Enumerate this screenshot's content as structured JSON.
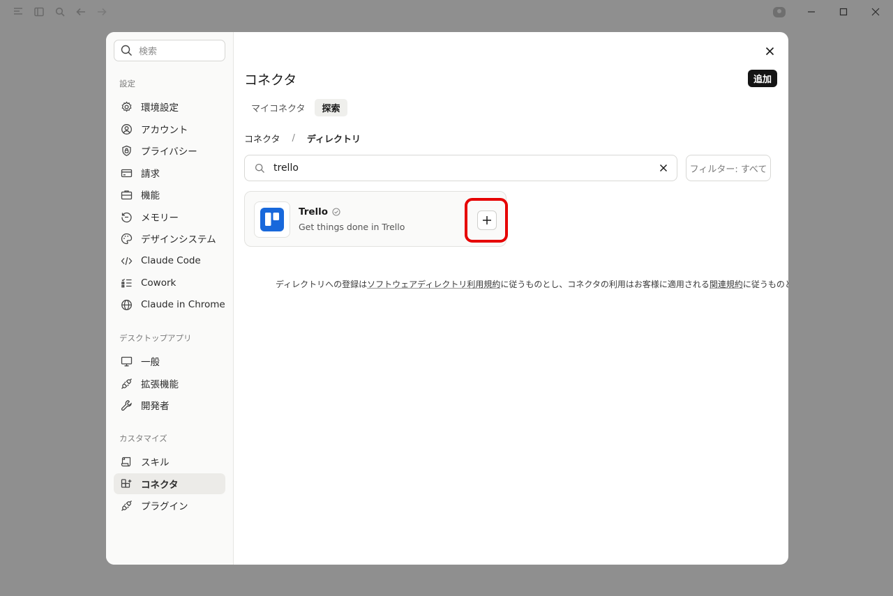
{
  "window": {
    "titlebar_icons": [
      "sidebar-toggle-icon",
      "panel-icon",
      "search-icon",
      "back-icon",
      "forward-icon"
    ],
    "controls": [
      "minimize-icon",
      "maximize-icon",
      "close-icon"
    ]
  },
  "sidebar": {
    "search_placeholder": "検索",
    "sections": [
      {
        "label": "設定",
        "items": [
          {
            "label": "環境設定",
            "icon": "gear-icon"
          },
          {
            "label": "アカウント",
            "icon": "user-circle-icon"
          },
          {
            "label": "プライバシー",
            "icon": "shield-lock-icon"
          },
          {
            "label": "請求",
            "icon": "credit-card-icon"
          },
          {
            "label": "機能",
            "icon": "briefcase-icon"
          },
          {
            "label": "メモリー",
            "icon": "history-icon"
          },
          {
            "label": "デザインシステム",
            "icon": "palette-icon"
          },
          {
            "label": "Claude Code",
            "icon": "code-icon"
          },
          {
            "label": "Cowork",
            "icon": "checklist-icon"
          },
          {
            "label": "Claude in Chrome",
            "icon": "globe-icon"
          }
        ]
      },
      {
        "label": "デスクトップアプリ",
        "items": [
          {
            "label": "一般",
            "icon": "monitor-icon"
          },
          {
            "label": "拡張機能",
            "icon": "plug-icon"
          },
          {
            "label": "開発者",
            "icon": "wrench-icon"
          }
        ]
      },
      {
        "label": "カスタマイズ",
        "items": [
          {
            "label": "スキル",
            "icon": "scroll-icon"
          },
          {
            "label": "コネクタ",
            "icon": "connector-icon",
            "active": true
          },
          {
            "label": "プラグイン",
            "icon": "plug-icon"
          }
        ]
      }
    ]
  },
  "main": {
    "title": "コネクタ",
    "add_label": "追加",
    "tabs": [
      {
        "label": "マイコネクタ",
        "active": false
      },
      {
        "label": "探索",
        "active": true
      }
    ],
    "breadcrumb": {
      "parent": "コネクタ",
      "separator": "/",
      "current": "ディレクトリ"
    },
    "search_value": "trello",
    "filter_label": "フィルター: すべて",
    "results": [
      {
        "name": "Trello",
        "description": "Get things done in Trello",
        "verified": true,
        "brand_color": "#1868db"
      }
    ],
    "terms": {
      "part1": "ディレクトリへの登録は",
      "link1": "ソフトウェアディレクトリ利用規約",
      "part2": "に従うものとし、コネクタの利用はお客様に適用される",
      "link2": "関連規約",
      "part3": "に従うものとします。"
    }
  },
  "colors": {
    "highlight": "#e60000",
    "accent_button": "#141414"
  }
}
